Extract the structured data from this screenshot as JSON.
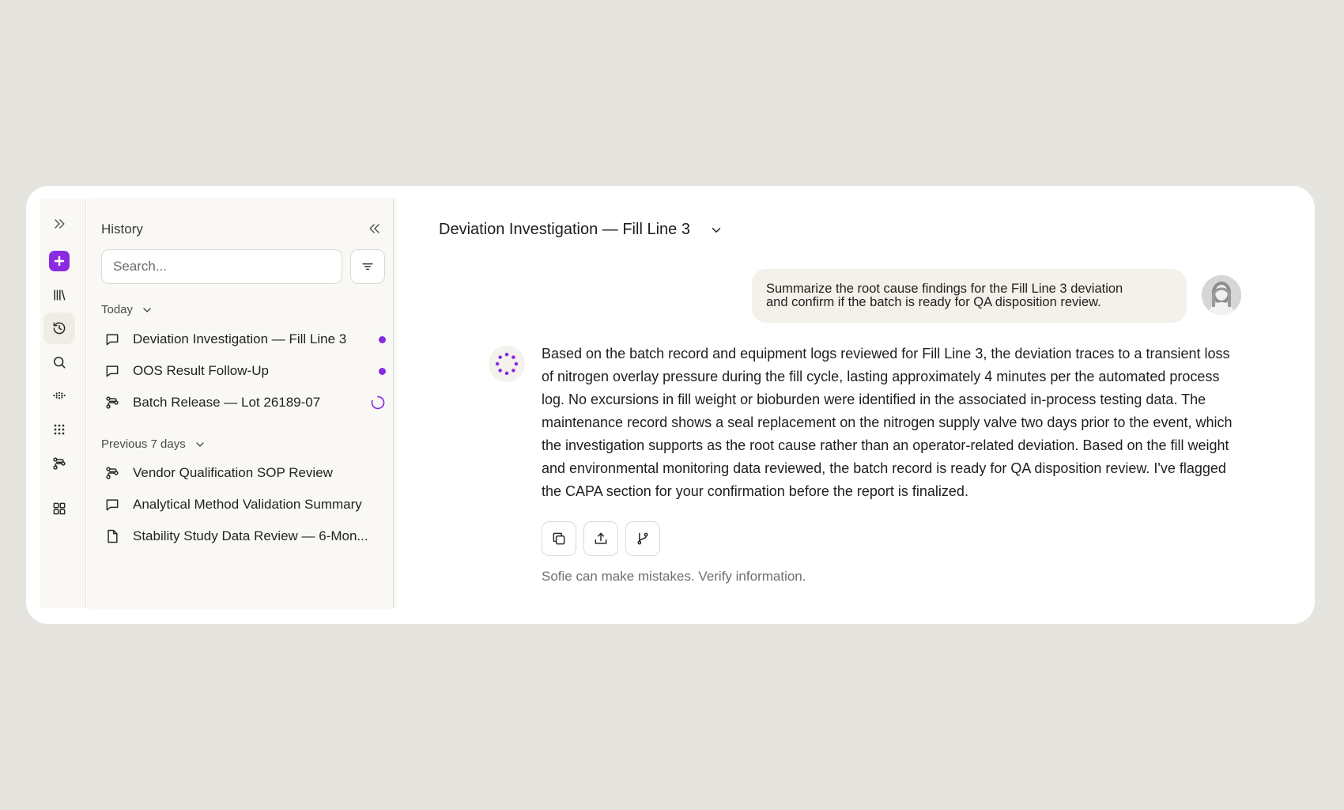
{
  "history": {
    "title": "History",
    "search_placeholder": "Search...",
    "sections": [
      {
        "label": "Today",
        "items": [
          {
            "label": "Deviation Investigation — Fill Line 3",
            "icon": "chat-icon",
            "status": "unread-dot"
          },
          {
            "label": "OOS Result Follow-Up",
            "icon": "chat-icon",
            "status": "unread-dot"
          },
          {
            "label": "Batch Release — Lot 26189-07",
            "icon": "workflow-icon",
            "status": "loading-spinner"
          }
        ]
      },
      {
        "label": "Previous 7 days",
        "items": [
          {
            "label": "Vendor Qualification SOP Review",
            "icon": "workflow-icon"
          },
          {
            "label": "Analytical Method Validation Summary",
            "icon": "chat-icon"
          },
          {
            "label": "Stability Study Data Review — 6-Mon...",
            "icon": "document-icon"
          }
        ]
      }
    ]
  },
  "conversation": {
    "title": "Deviation Investigation — Fill Line 3",
    "user_message_line1": "Summarize the root cause findings for the Fill Line 3 deviation",
    "user_message_line2": "and confirm if the batch is ready for QA disposition review.",
    "assistant_message": "Based on the batch record and equipment logs reviewed for Fill Line 3, the deviation traces to a transient loss of nitrogen overlay pressure during the fill cycle, lasting approximately 4 minutes per the automated process log. No excursions in fill weight or bioburden were identified in the associated in-process testing data. The maintenance record shows a seal replacement on the nitrogen supply valve two days prior to the event, which the investigation supports as the root cause rather than an operator-related deviation. Based on the fill weight and environmental monitoring data reviewed, the batch record is ready for QA disposition review. I've flagged the CAPA section for your confirmation before the report is finalized.",
    "disclaimer": "Sofie can make mistakes. Verify information."
  },
  "colors": {
    "accent": "#8a2be2",
    "background": "#e6e4df",
    "panel": "#f9f8f5",
    "bubble": "#f3f1ea"
  }
}
